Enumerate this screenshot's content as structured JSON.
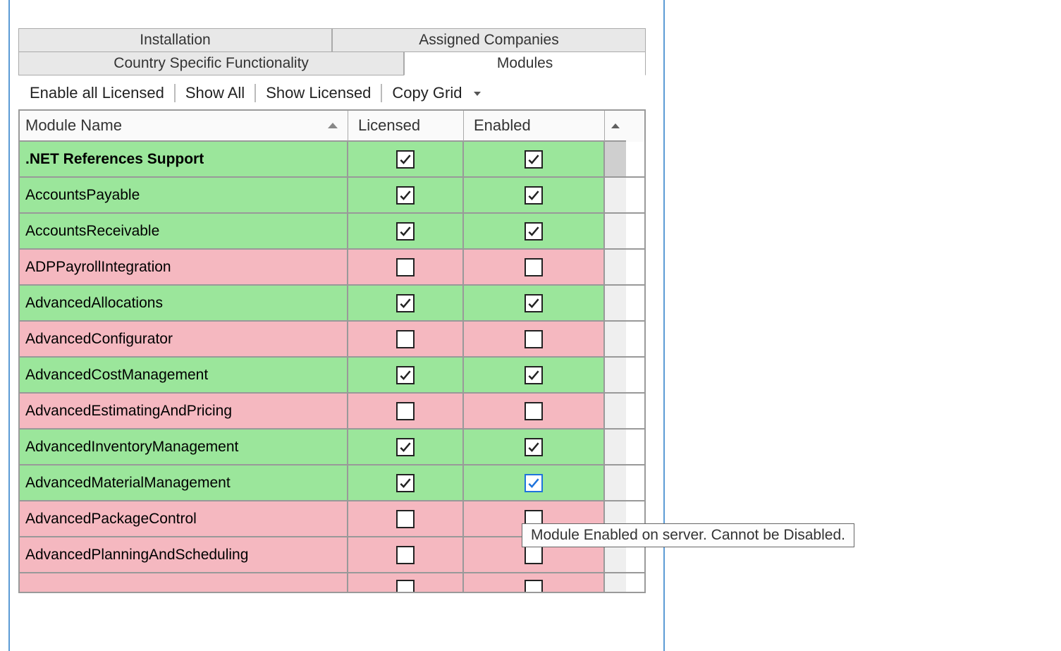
{
  "tabs": {
    "row1": [
      "Installation",
      "Assigned Companies"
    ],
    "row2": [
      "Country Specific Functionality",
      "Modules"
    ]
  },
  "active_tab": "Modules",
  "toolbar": {
    "enable_all": "Enable all Licensed",
    "show_all": "Show All",
    "show_licensed": "Show Licensed",
    "copy_grid": "Copy Grid"
  },
  "columns": {
    "name": "Module Name",
    "licensed": "Licensed",
    "enabled": "Enabled"
  },
  "tooltip": "Module Enabled on server. Cannot be Disabled.",
  "rows": [
    {
      "name": ".NET References Support",
      "bold": true,
      "licensed": true,
      "enabled": true,
      "color": "green"
    },
    {
      "name": "AccountsPayable",
      "bold": false,
      "licensed": true,
      "enabled": true,
      "color": "green"
    },
    {
      "name": "AccountsReceivable",
      "bold": false,
      "licensed": true,
      "enabled": true,
      "color": "green"
    },
    {
      "name": "ADPPayrollIntegration",
      "bold": false,
      "licensed": false,
      "enabled": false,
      "color": "pink"
    },
    {
      "name": "AdvancedAllocations",
      "bold": false,
      "licensed": true,
      "enabled": true,
      "color": "green"
    },
    {
      "name": "AdvancedConfigurator",
      "bold": false,
      "licensed": false,
      "enabled": false,
      "color": "pink"
    },
    {
      "name": "AdvancedCostManagement",
      "bold": false,
      "licensed": true,
      "enabled": true,
      "color": "green"
    },
    {
      "name": "AdvancedEstimatingAndPricing",
      "bold": false,
      "licensed": false,
      "enabled": false,
      "color": "pink"
    },
    {
      "name": "AdvancedInventoryManagement",
      "bold": false,
      "licensed": true,
      "enabled": true,
      "color": "green"
    },
    {
      "name": "AdvancedMaterialManagement",
      "bold": false,
      "licensed": true,
      "enabled": true,
      "color": "green",
      "enabled_focused": true
    },
    {
      "name": "AdvancedPackageControl",
      "bold": false,
      "licensed": false,
      "enabled": false,
      "color": "pink"
    },
    {
      "name": "AdvancedPlanningAndScheduling",
      "bold": false,
      "licensed": false,
      "enabled": false,
      "color": "pink"
    },
    {
      "name": "",
      "bold": false,
      "licensed": false,
      "enabled": false,
      "color": "pink",
      "partial": true
    }
  ]
}
